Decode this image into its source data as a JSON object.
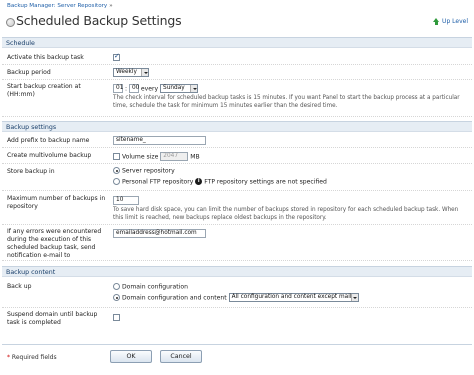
{
  "breadcrumb": {
    "item1": "Backup Manager: Server Repository",
    "sep": "»"
  },
  "page": {
    "title": "Scheduled Backup Settings",
    "up_level": "Up Level"
  },
  "schedule": {
    "header": "Schedule",
    "activate_label": "Activate this backup task",
    "activate_checked": true,
    "period_label": "Backup period",
    "period_value": "Weekly",
    "start_label": "Start backup creation at (HH:mm)",
    "hour": "01",
    "colon": ":",
    "minute": "00",
    "every_label": "every",
    "day_value": "Sunday",
    "hint": "The check interval for scheduled backup tasks is 15 minutes. If you want Panel to start the backup process at a particular time, schedule the task for minimum 15 minutes earlier than the desired time."
  },
  "backup_settings": {
    "header": "Backup settings",
    "prefix_label": "Add prefix to backup name",
    "prefix_value": "sitename_",
    "multivolume_label": "Create multivolume backup",
    "volume_size_label": "Volume size",
    "volume_size_value": "2047",
    "volume_unit": "MB",
    "store_label": "Store backup in",
    "store_option1": "Server repository",
    "store_option2": "Personal FTP repository",
    "ftp_note": "FTP repository settings are not specified",
    "max_label": "Maximum number of backups in repository",
    "max_value": "10",
    "max_hint": "To save hard disk space, you can limit the number of backups stored in repository for each scheduled backup task. When this limit is reached, new backups replace oldest backups in the repository.",
    "email_label": "If any errors were encountered during the execution of this scheduled backup task, send notification e-mail to",
    "email_value": "emailaddress@hotmail.com"
  },
  "backup_content": {
    "header": "Backup content",
    "backup_up_label": "Back up",
    "option1": "Domain configuration",
    "option2": "Domain configuration and content",
    "content_select": "All configuration and content except mail",
    "suspend_label": "Suspend domain until backup task is completed"
  },
  "footer": {
    "required_star": "*",
    "required_text": "Required fields",
    "ok": "OK",
    "cancel": "Cancel"
  }
}
